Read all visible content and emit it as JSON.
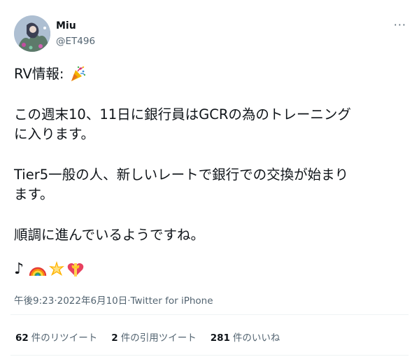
{
  "user": {
    "name": "Miu",
    "handle": "@ET496",
    "more_label": "···"
  },
  "tweet": {
    "line1": "RV情報:",
    "line2": "この週末10、11日に銀行員はGCRの為のトレーニング\nに入ります。",
    "line3": "Tier5一般の人、新しいレートで銀行での交換が始まり\nます。",
    "line4": "順調に進んでいるようですね。",
    "note": "♪"
  },
  "icons": [
    "party-popper-icon",
    "rainbow-icon",
    "glowing-star-icon",
    "heart-with-ribbon-icon"
  ],
  "meta": {
    "time": "午後9:23",
    "sep1": " · ",
    "date": "2022年6月10日",
    "sep2": " · ",
    "source": "Twitter for iPhone"
  },
  "stats": {
    "retweets_count": "62",
    "retweets_label": "件のリツイート",
    "quotes_count": "2",
    "quotes_label": "件の引用ツイート",
    "likes_count": "281",
    "likes_label": "件のいいね"
  },
  "colors": {
    "text": "#0f1419",
    "secondary": "#536471",
    "divider": "#eff3f4"
  }
}
